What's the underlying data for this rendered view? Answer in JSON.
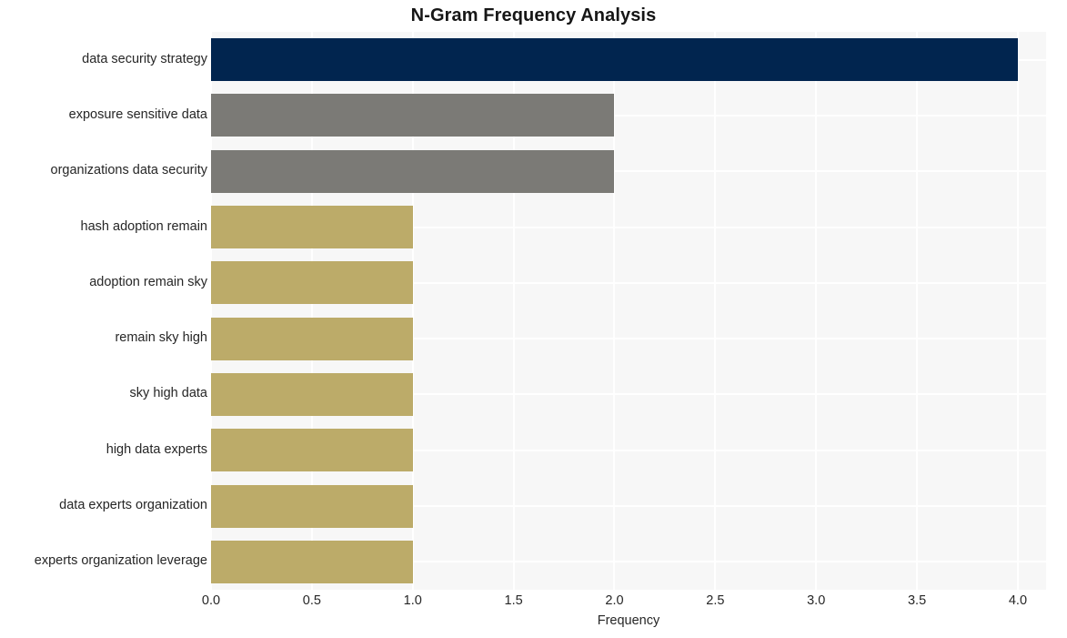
{
  "chart_data": {
    "type": "bar",
    "orientation": "horizontal",
    "title": "N-Gram Frequency Analysis",
    "xlabel": "Frequency",
    "ylabel": "",
    "categories": [
      "data security strategy",
      "exposure sensitive data",
      "organizations data security",
      "hash adoption remain",
      "adoption remain sky",
      "remain sky high",
      "sky high data",
      "high data experts",
      "data experts organization",
      "experts organization leverage"
    ],
    "values": [
      4.0,
      2.0,
      2.0,
      1.0,
      1.0,
      1.0,
      1.0,
      1.0,
      1.0,
      1.0
    ],
    "bar_colors": [
      "#01254f",
      "#7b7a76",
      "#7b7a76",
      "#bcab69",
      "#bcab69",
      "#bcab69",
      "#bcab69",
      "#bcab69",
      "#bcab69",
      "#bcab69"
    ],
    "xticks": [
      "0.0",
      "0.5",
      "1.0",
      "1.5",
      "2.0",
      "2.5",
      "3.0",
      "3.5",
      "4.0"
    ],
    "xtick_values": [
      0.0,
      0.5,
      1.0,
      1.5,
      2.0,
      2.5,
      3.0,
      3.5,
      4.0
    ],
    "xlim": [
      0.0,
      4.14
    ],
    "grid": true,
    "legend": "none",
    "plot_background": "#f7f7f7",
    "grid_color": "#ffffff",
    "figure_background": "#ffffff",
    "text_color": "#262626",
    "title_color": "#161616"
  }
}
